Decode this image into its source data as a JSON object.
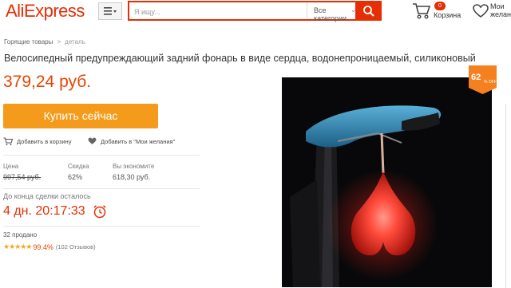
{
  "header": {
    "logo": "AliExpress",
    "search_placeholder": "Я ищу...",
    "category": "Все категории",
    "cart_count": "0",
    "cart_label": "Корзина",
    "wish_label_line1": "Мои",
    "wish_label_line2": "желан"
  },
  "breadcrumb": {
    "home": "Горящие товары",
    "sep": ">",
    "current": "деталь"
  },
  "product": {
    "title": "Велосипедный предупреждающий задний фонарь в виде сердца, водонепроницаемый, силиконовый",
    "price": "379,24 руб.",
    "buy_label": "Купить сейчас",
    "add_cart": "Добавить в корзину",
    "add_wish": "Добавить в \"Мои желания\"",
    "stats": {
      "price_label": "Цена",
      "price_value": "997,54 руб.",
      "discount_label": "Скидка",
      "discount_value": "62%",
      "saved_label": "Вы экономите",
      "saved_value": "618,30 руб."
    },
    "deal_label": "До конца сделки осталось",
    "countdown": "4 дн. 20:17:33",
    "sold": "32 продано",
    "rating_pct": "99.4%",
    "rating_count": "(102 Отзывов)",
    "badge_pct": "62",
    "badge_off": "% OFF"
  },
  "colors": {
    "brand": "#e62e04",
    "price": "#e64500",
    "buy": "#f59b1b",
    "star": "#f7a41d"
  }
}
